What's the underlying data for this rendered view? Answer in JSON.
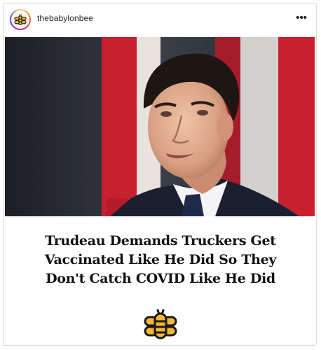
{
  "post": {
    "username": "thebabylonbee",
    "more_label": "•••",
    "avatar_icon": "babylon-bee-logo-icon",
    "photo_icon": "speaker-photo",
    "headline": {
      "line1": "Trudeau Demands Truckers Get",
      "line2": "Vaccinated Like He Did So They",
      "line3": "Don't Catch COVID Like He Did"
    },
    "logo_icon": "babylon-bee-logo-icon"
  },
  "colors": {
    "bee_yellow": "#f2b632",
    "bee_dark": "#1a1a1a",
    "flag_red": "#c8202f",
    "suit": "#1b2030",
    "tie": "#1f2a4a"
  }
}
